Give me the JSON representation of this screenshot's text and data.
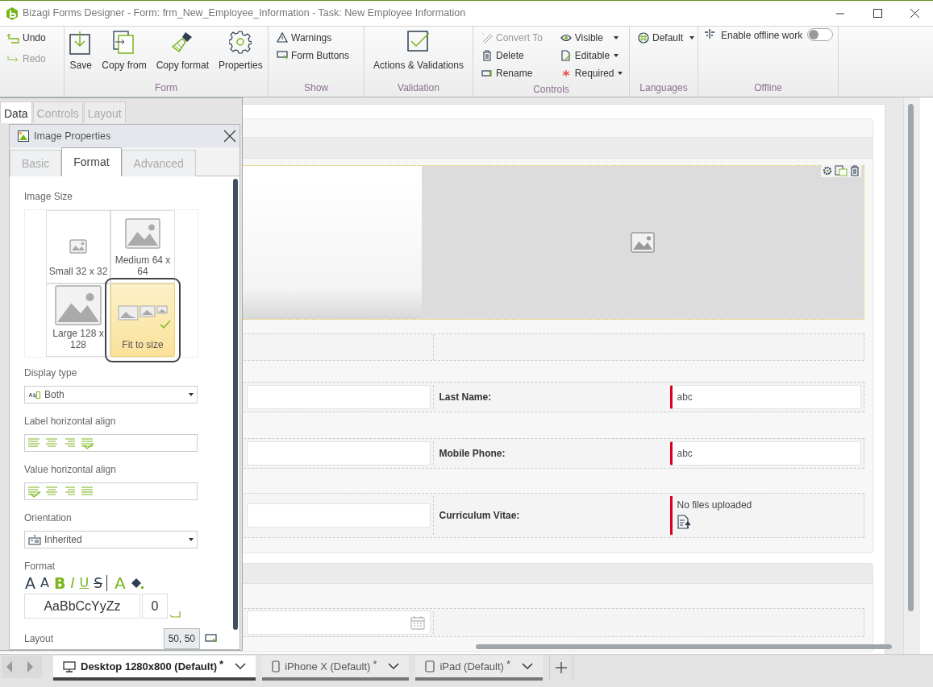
{
  "window": {
    "title": "Bizagi Forms Designer  - Form: frm_New_Employee_Information - Task:  New Employee Information"
  },
  "ribbon": {
    "history": [
      {
        "label": "Undo",
        "disabled": false
      },
      {
        "label": "Redo",
        "disabled": true
      }
    ],
    "groups": [
      {
        "label": "Form",
        "kind": "large",
        "items": [
          {
            "label": "Save"
          },
          {
            "label": "Copy from"
          },
          {
            "label": "Copy format"
          },
          {
            "label": "Properties"
          }
        ]
      },
      {
        "label": "Show",
        "kind": "small",
        "items": [
          {
            "label": "Warnings",
            "disabled": false,
            "dropdown": false
          },
          {
            "label": "Form Buttons",
            "disabled": false,
            "dropdown": false
          }
        ]
      },
      {
        "label": "Validation",
        "kind": "large",
        "items": [
          {
            "label": "Actions & Validations"
          }
        ]
      },
      {
        "label": "Controls",
        "kind": "small",
        "items": [
          {
            "label": "Convert To",
            "disabled": true,
            "dropdown": false
          },
          {
            "label": "Delete",
            "disabled": false,
            "dropdown": false
          },
          {
            "label": "Rename",
            "disabled": false,
            "dropdown": false
          },
          {
            "label": "Visible",
            "disabled": false,
            "dropdown": true
          },
          {
            "label": "Editable",
            "disabled": false,
            "dropdown": true
          },
          {
            "label": "Required",
            "disabled": false,
            "dropdown": true
          }
        ]
      },
      {
        "label": "Languages",
        "kind": "small",
        "items": [
          {
            "label": "Default",
            "disabled": false,
            "dropdown": true
          }
        ]
      },
      {
        "label": "Offline",
        "kind": "toggle",
        "items": [
          {
            "label": "Enable offline work",
            "on": false
          }
        ]
      }
    ]
  },
  "panel": {
    "tabs": [
      {
        "label": "Data",
        "selected": true
      },
      {
        "label": "Controls",
        "selected": false
      },
      {
        "label": "Layout",
        "selected": false
      }
    ],
    "dialog": {
      "title": "Image Properties",
      "tabs": [
        {
          "label": "Basic",
          "selected": false
        },
        {
          "label": "Format",
          "selected": true
        },
        {
          "label": "Advanced",
          "selected": false
        }
      ],
      "image_size": {
        "label": "Image Size",
        "options": [
          {
            "label": "Small 32 x 32",
            "selected": false
          },
          {
            "label": "Medium 64 x 64",
            "selected": false
          },
          {
            "label": "Large 128 x 128",
            "selected": false
          },
          {
            "label": "Fit to size",
            "selected": true
          }
        ]
      },
      "display_type": {
        "label": "Display type",
        "value": "Both"
      },
      "label_align": {
        "label": "Label horizontal align",
        "options": [
          {
            "selected": false
          },
          {
            "selected": false
          },
          {
            "selected": false
          },
          {
            "selected": true
          }
        ]
      },
      "value_align": {
        "label": "Value horizontal align",
        "options": [
          {
            "selected": true
          },
          {
            "selected": false
          },
          {
            "selected": false
          },
          {
            "selected": false
          }
        ]
      },
      "orientation": {
        "label": "Orientation",
        "value": "Inherited"
      },
      "format": {
        "label": "Format",
        "buttons": [
          {
            "kind": "grow",
            "text": "A"
          },
          {
            "kind": "shrink",
            "text": "A"
          },
          {
            "kind": "bold",
            "text": "B"
          },
          {
            "kind": "italic",
            "text": "I"
          },
          {
            "kind": "underline",
            "text": "U"
          },
          {
            "kind": "strike",
            "text": "S"
          },
          {
            "kind": "color",
            "text": "A"
          }
        ],
        "preview": "AaBbCcYyZz",
        "spacing": "0"
      },
      "layout": {
        "label": "Layout",
        "value": "50, 50"
      }
    }
  },
  "canvas": {
    "sections": [
      {
        "rows": [
          {
            "kind": "image"
          },
          {
            "kind": "empty"
          },
          {
            "kind": "fields",
            "cells": [
              {
                "kind": "input",
                "required": false
              },
              {
                "kind": "input",
                "label": "Last Name:",
                "value": "abc",
                "required": true
              }
            ]
          },
          {
            "kind": "fields",
            "cells": [
              {
                "kind": "input",
                "required": false
              },
              {
                "kind": "input",
                "label": "Mobile Phone:",
                "value": "abc",
                "required": true
              }
            ]
          },
          {
            "kind": "fields",
            "cells": [
              {
                "kind": "input",
                "required": false
              },
              {
                "kind": "file",
                "label": "Curriculum Vitae:",
                "value": "No files uploaded",
                "required": true
              }
            ]
          }
        ]
      },
      {
        "rows": [
          {
            "kind": "fields",
            "cells": [
              {
                "kind": "date",
                "required": false
              },
              {
                "kind": "empty"
              }
            ]
          }
        ]
      }
    ]
  },
  "devices": [
    {
      "label": "Desktop 1280x800 (Default)",
      "mark": "*",
      "kind": "desktop",
      "selected": true
    },
    {
      "label": "iPhone X (Default)",
      "mark": "*",
      "kind": "phone",
      "selected": false
    },
    {
      "label": "iPad (Default)",
      "mark": "*",
      "kind": "tablet",
      "selected": false
    }
  ]
}
